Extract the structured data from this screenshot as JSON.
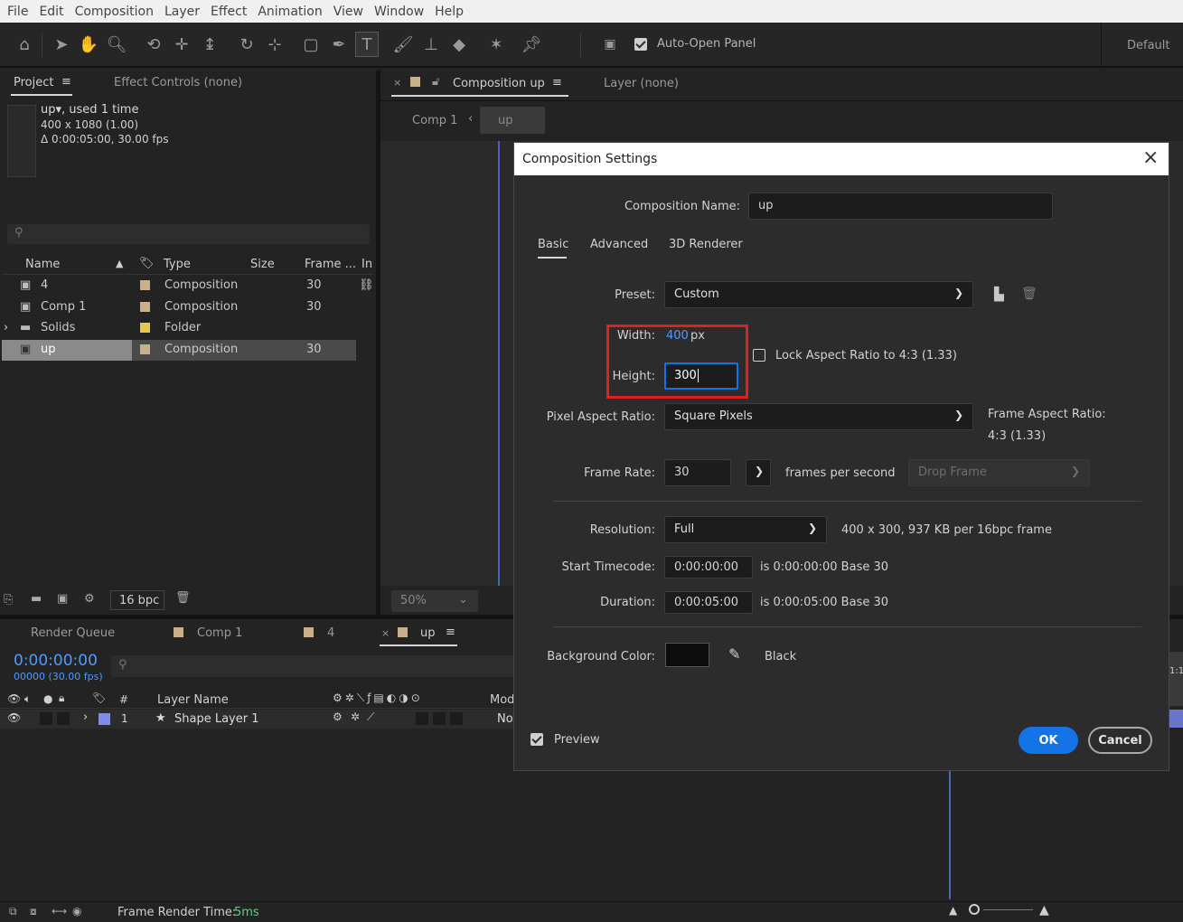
{
  "menu": [
    "File",
    "Edit",
    "Composition",
    "Layer",
    "Effect",
    "Animation",
    "View",
    "Window",
    "Help"
  ],
  "toolbar": {
    "auto_open_label": "Auto-Open Panel",
    "workspace": "Default"
  },
  "project_panel": {
    "tab_project": "Project",
    "tab_effect_controls": "Effect Controls (none)",
    "info_name": "up",
    "info_used": ", used 1 time",
    "info_size": "400 x 1080 (1.00)",
    "info_duration": "Δ 0:00:05:00, 30.00 fps",
    "columns": {
      "name": "Name",
      "type": "Type",
      "size": "Size",
      "frame": "Frame ...",
      "in": "In"
    },
    "items": [
      {
        "name": "4",
        "type": "Composition",
        "frame": "30",
        "color": "#c8b08a"
      },
      {
        "name": "Comp 1",
        "type": "Composition",
        "frame": "30",
        "color": "#c8b08a"
      },
      {
        "name": "Solids",
        "type": "Folder",
        "frame": "",
        "color": "#e8c84a"
      },
      {
        "name": "up",
        "type": "Composition",
        "frame": "30",
        "color": "#c8b08a"
      }
    ],
    "bpc": "16 bpc"
  },
  "comp_panel": {
    "tab_comp": "Composition up",
    "tab_layer": "Layer (none)",
    "breadcrumb_parent": "Comp 1",
    "breadcrumb_current": "up",
    "zoom": "50%"
  },
  "timeline": {
    "tab_render_queue": "Render Queue",
    "tab_comp1": "Comp 1",
    "tab_4": "4",
    "tab_up": "up",
    "timecode": "0:00:00:00",
    "frame_info": "00000 (30.00 fps)",
    "col_num": "#",
    "col_layer_name": "Layer Name",
    "col_mode": "Mod",
    "layer_num": "1",
    "layer_name": "Shape Layer 1",
    "layer_mode": "No",
    "ruler_label": "1:1",
    "frame_render_label": "Frame Render Time:",
    "frame_render_value": "5ms"
  },
  "dialog": {
    "title": "Composition Settings",
    "comp_name_label": "Composition Name:",
    "comp_name_value": "up",
    "tabs": {
      "basic": "Basic",
      "advanced": "Advanced",
      "renderer": "3D Renderer"
    },
    "preset_label": "Preset:",
    "preset_value": "Custom",
    "width_label": "Width:",
    "width_value": "400",
    "width_unit": "px",
    "height_label": "Height:",
    "height_value": "300",
    "lock_aspect_label": "Lock Aspect Ratio to 4:3 (1.33)",
    "pixel_aspect_label": "Pixel Aspect Ratio:",
    "pixel_aspect_value": "Square Pixels",
    "frame_aspect_label": "Frame Aspect Ratio:",
    "frame_aspect_value": "4:3 (1.33)",
    "frame_rate_label": "Frame Rate:",
    "frame_rate_value": "30",
    "fps_label": "frames per second",
    "drop_frame": "Drop Frame",
    "resolution_label": "Resolution:",
    "resolution_value": "Full",
    "resolution_info": "400 x 300, 937 KB per 16bpc frame",
    "start_tc_label": "Start Timecode:",
    "start_tc_value": "0:00:00:00",
    "start_tc_info": "is 0:00:00:00  Base 30",
    "duration_label": "Duration:",
    "duration_value": "0:00:05:00",
    "duration_info": "is 0:00:05:00  Base 30",
    "bg_color_label": "Background Color:",
    "bg_color_name": "Black",
    "preview_label": "Preview",
    "ok_label": "OK",
    "cancel_label": "Cancel"
  },
  "colors": {
    "accent": "#1473e6",
    "highlight": "#e02020",
    "link": "#4d9bff"
  }
}
